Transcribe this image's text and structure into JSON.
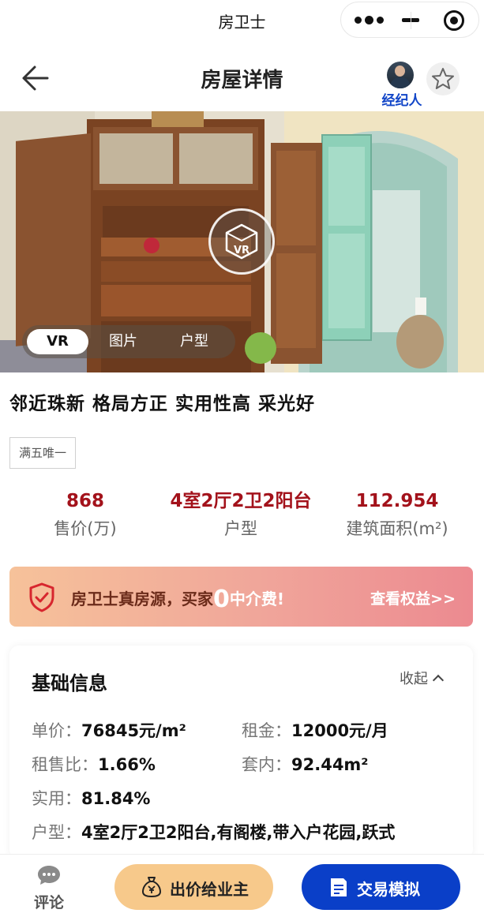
{
  "app": {
    "title": "房卫士"
  },
  "navbar": {
    "title": "房屋详情",
    "agent_label": "经纪人"
  },
  "media": {
    "tabs": [
      "VR",
      "图片",
      "户型"
    ],
    "active_tab": "VR",
    "vr_badge": "VR"
  },
  "listing": {
    "headline": "邻近珠新 格局方正 实用性高 采光好",
    "tag": "满五唯一",
    "stats": [
      {
        "value": "868",
        "label": "售价(万)"
      },
      {
        "value": "4室2厅2卫2阳台",
        "label": "户型"
      },
      {
        "value": "112.954",
        "label": "建筑面积(m²)"
      }
    ]
  },
  "promo": {
    "text_before": "房卫士真房源，买家",
    "zero": "0",
    "text_after": "中介费!",
    "link": "查看权益>>"
  },
  "info": {
    "title": "基础信息",
    "collapse_label": "收起",
    "unit_price_key": "单价：",
    "unit_price": "76845元/m²",
    "rent_key": "租金：",
    "rent": "12000元/月",
    "rent_ratio_key": "租售比：",
    "rent_ratio": "1.66%",
    "inner_key": "套内：",
    "inner": "92.44m²",
    "usable_key": "实用：",
    "usable": "81.84%",
    "layout_key": "户型：",
    "layout": "4室2厅2卫2阳台,有阁楼,带入户花园,跃式"
  },
  "footer": {
    "comment": "评论",
    "offer": "出价给业主",
    "simulate": "交易模拟"
  },
  "colors": {
    "price": "#a3121b",
    "primary": "#0a3fc8",
    "offer": "#f7c98b"
  }
}
